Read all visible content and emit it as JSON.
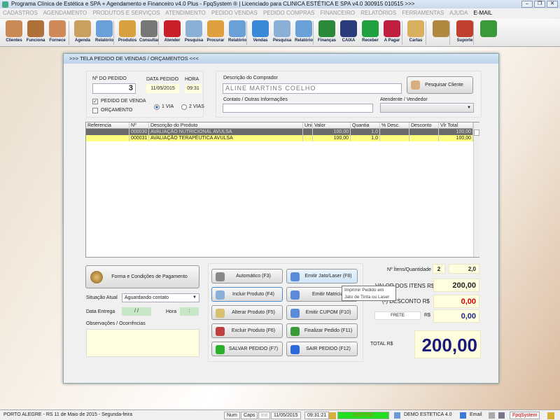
{
  "window": {
    "title": "Programa Clínica de Estética e SPA + Agendamento e Financeiro v4.0 Plus - FpqSystem ® | Licenciado para  CLINICA ESTÉTICA E SPA v4.0 300915 010515 >>>",
    "min": "–",
    "max": "❐",
    "close": "✕"
  },
  "menu": [
    "CADASTROS",
    "AGENDAMENTO",
    "PRODUTOS E SERVIÇOS",
    "ATENDIMENTO",
    "PEDIDO VENDAS",
    "PEDIDO COMPRAS",
    "FINANCEIRO",
    "RELATÓRIOS",
    "FERRAMENTAS",
    "AJUDA",
    "E-MAIL"
  ],
  "toolbar": [
    {
      "label": "Clientes",
      "color": "#c98a55"
    },
    {
      "label": "Funciona",
      "color": "#b0703a"
    },
    {
      "label": "Fornece",
      "color": "#d08a5a"
    },
    {
      "label": "Agenda",
      "color": "#c9a060"
    },
    {
      "label": "Relatório",
      "color": "#6aa0d8"
    },
    {
      "label": "Produtos",
      "color": "#d8a040"
    },
    {
      "label": "Consultar",
      "color": "#777"
    },
    {
      "label": "Atender",
      "color": "#c8202a"
    },
    {
      "label": "Pesquisa",
      "color": "#8ab0d8"
    },
    {
      "label": "Procurar",
      "color": "#e0a040"
    },
    {
      "label": "Relatório",
      "color": "#6aa0d8"
    },
    {
      "label": "Vendas",
      "color": "#3a8ad8"
    },
    {
      "label": "Pesquisa",
      "color": "#8ab0d8"
    },
    {
      "label": "Relatório",
      "color": "#6aa0d8"
    },
    {
      "label": "Finanças",
      "color": "#2a8a3a"
    },
    {
      "label": "CAIXA",
      "color": "#2a3a7a"
    },
    {
      "label": "Receber",
      "color": "#20a040"
    },
    {
      "label": "A Pagar",
      "color": "#c02040"
    },
    {
      "label": "Cartas",
      "color": "#d8b060"
    },
    {
      "label": "",
      "color": "#b08840"
    },
    {
      "label": "Suporte",
      "color": "#c04030"
    },
    {
      "label": "",
      "color": "#3a9a3a"
    }
  ],
  "dialog": {
    "title": ">>>  TELA PEDIDO DE VENDAS / ORÇAMENTOS  <<<",
    "pedido_label": "Nº DO PEDIDO",
    "pedido": "3",
    "data_label": "DATA PEDIDO",
    "data": "11/05/2015",
    "hora_label": "HORA",
    "hora": "09:31",
    "chk_venda": "PEDIDO DE VENDA",
    "chk_venda_mark": "✓",
    "chk_orcamento": "ORÇAMENTO",
    "radio_1via": "1 VIA",
    "radio_2vias": "2 VIAS",
    "comprador_label": "Descrição do Comprador",
    "comprador": "ALINE MARTINS COELHO",
    "pesquisar": "Pesquisar Cliente",
    "contato_label": "Contato / Outras Informações",
    "contato": "",
    "atendente_label": "Atendente / Vendedor",
    "atendente": "",
    "grid": {
      "headers": [
        "Referencia",
        "Nº",
        "Descrição do Produto",
        "Uni",
        "Valor",
        "Quantia",
        "% Desc.",
        "Desconto",
        "Vlr Total"
      ],
      "rows": [
        [
          "",
          "000030",
          "AVALIAÇÃO NUTRICIONAL AVULSA",
          "",
          "100,00",
          "1,0",
          "",
          "",
          "100,00"
        ],
        [
          "",
          "000031",
          "AVALIAÇÃO TERAPÊUTICA AVULSA",
          "",
          "100,00",
          "1,0",
          "",
          "",
          "100,00"
        ]
      ]
    },
    "pagamento": "Forma e Condições de Pagamento",
    "situacao_label": "Situação Atual",
    "situacao": "Aguardando contato",
    "entrega_label": "Data  Entrega",
    "entrega": "/ /",
    "hora2_label": "Hora",
    "hora2": ":",
    "obs_label": "Observações / Ocorrências",
    "obs": "",
    "buttons": [
      "Automático     (F3)",
      "Emitir Jato/Laser (F8)",
      "Incluir Produto  (F4)",
      "Emitir Matricial",
      "Alterar Produto  (F5)",
      "Emitir CUPOM   (F10)",
      "Excluir Produto  (F6)",
      "Finalizar Pedido  (F11)",
      "SALVAR PEDIDO (F7)",
      "SAIR  PEDIDO  (F12)"
    ],
    "tooltip": [
      "Imprimir Pedido em",
      "Jato de Tinta ou Laser"
    ],
    "itens_label": "Nº Ítens/Quantidade",
    "itens": "2",
    "quantidade": "2,0",
    "valor_label": "VALOR DOS ITENS R$",
    "valor": "200,00",
    "desconto_label": "(-) DESCONTO R$",
    "desconto": "0,00",
    "frete_label": "FRETE",
    "frete_rs": "R$",
    "frete": "0,00",
    "total_label": "TOTAL R$",
    "total": "200,00"
  },
  "status": {
    "location": "PORTO ALEGRE - RS 11 de Maio de 2015 - Segunda-feira",
    "num": "Num",
    "caps": "Caps",
    "ins": "Ins",
    "date": "11/05/2015",
    "time": "09:31:21",
    "user": "MASTER",
    "company": "DEMO ESTETICA 4.0",
    "email": "Email",
    "brand": "FpqSystem"
  }
}
